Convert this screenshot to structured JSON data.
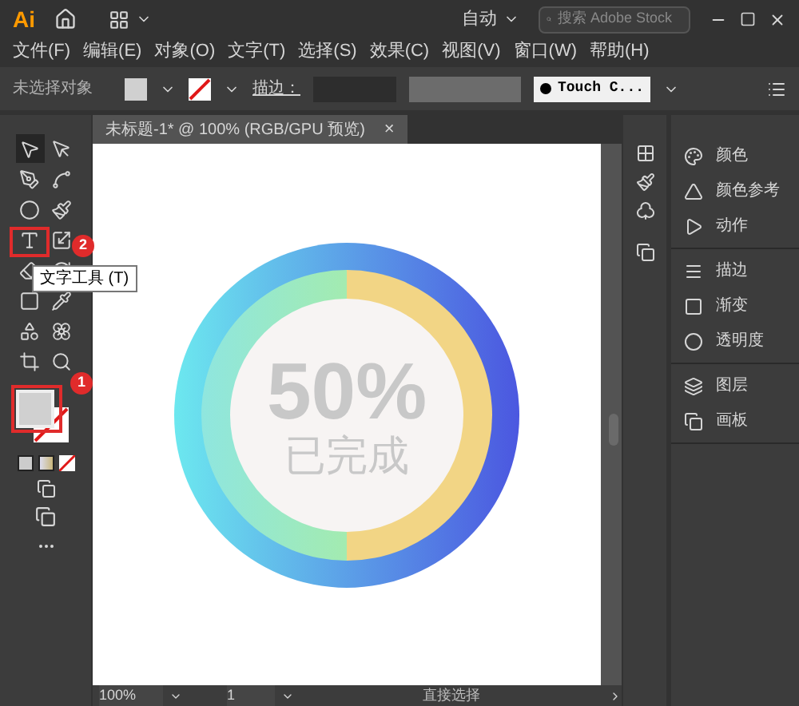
{
  "title_bar": {
    "logo": "Ai",
    "workspace": "自动",
    "search": {
      "placeholder": "搜索 Adobe Stock"
    }
  },
  "menu": [
    "文件(F)",
    "编辑(E)",
    "对象(O)",
    "文字(T)",
    "选择(S)",
    "效果(C)",
    "视图(V)",
    "窗口(W)",
    "帮助(H)"
  ],
  "control_bar": {
    "selection": "未选择对象",
    "stroke_label": "描边：",
    "brush": "Touch C..."
  },
  "tools": [
    {
      "selected": true
    },
    {
      "selected": false
    },
    {
      "selected": false
    },
    {
      "selected": false
    },
    {
      "selected": false
    },
    {
      "selected": false
    },
    {
      "selected": false
    },
    {
      "selected": false
    },
    {
      "selected": false
    },
    {
      "selected": false
    },
    {
      "selected": false
    },
    {
      "selected": false
    },
    {
      "selected": false
    },
    {
      "selected": false
    },
    {
      "selected": false
    },
    {
      "selected": false
    }
  ],
  "document_tab": {
    "title": "未标题-1* @ 100% (RGB/GPU 预览)",
    "close": "×"
  },
  "artwork": {
    "percent": "50%",
    "caption": "已完成"
  },
  "tooltip": "文字工具 (T)",
  "callouts": [
    "2",
    "1"
  ],
  "panel_groups": [
    {
      "items": [
        "颜色",
        "颜色参考",
        "动作"
      ]
    },
    {
      "items": [
        "描边",
        "渐变",
        "透明度"
      ]
    },
    {
      "items": [
        "图层",
        "画板"
      ]
    }
  ],
  "status_bar": {
    "zoom": "100%",
    "page": "1",
    "tool": "直接选择"
  }
}
